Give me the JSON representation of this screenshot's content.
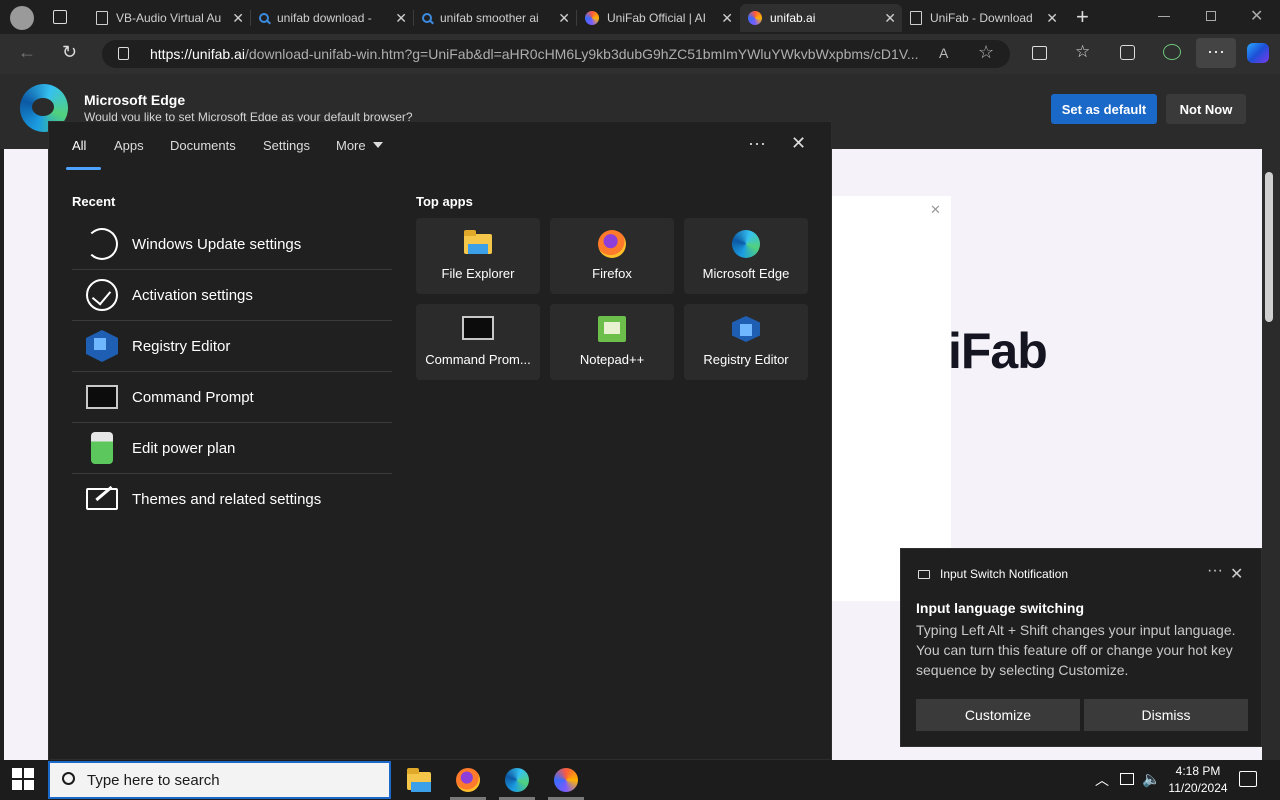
{
  "browser": {
    "tabs": [
      {
        "title": "VB-Audio Virtual Au",
        "icon": "page-icon"
      },
      {
        "title": "unifab download - ",
        "icon": "search-icon"
      },
      {
        "title": "unifab smoother ai",
        "icon": "search-icon"
      },
      {
        "title": "UniFab Official | AI",
        "icon": "unifab-icon"
      },
      {
        "title": "unifab.ai",
        "icon": "unifab-icon",
        "active": true
      },
      {
        "title": "UniFab - Download",
        "icon": "page-icon"
      }
    ],
    "url_host": "https://unifab.ai",
    "url_rest": "/download-unifab-win.htm?g=UniFab&dl=aHR0cHM6Ly9kb3dubG9hZC51bmImYWluYWkvbWxpbms/cD1V..."
  },
  "banner": {
    "title": "Microsoft Edge",
    "subtitle": "Would you like to set Microsoft Edge as your default browser?",
    "set_default": "Set as default",
    "not_now": "Not Now"
  },
  "webpage": {
    "brand_text": "iFab"
  },
  "search": {
    "tabs": [
      "All",
      "Apps",
      "Documents",
      "Settings",
      "More"
    ],
    "recent_title": "Recent",
    "recent": [
      {
        "label": "Windows Update settings",
        "icon": "refresh-icon"
      },
      {
        "label": "Activation settings",
        "icon": "check-circle-icon"
      },
      {
        "label": "Registry Editor",
        "icon": "registry-editor-icon"
      },
      {
        "label": "Command Prompt",
        "icon": "command-prompt-icon"
      },
      {
        "label": "Edit power plan",
        "icon": "battery-icon"
      },
      {
        "label": "Themes and related settings",
        "icon": "themes-icon"
      }
    ],
    "top_apps_title": "Top apps",
    "top_apps": [
      {
        "label": "File Explorer",
        "icon": "file-explorer-icon"
      },
      {
        "label": "Firefox",
        "icon": "firefox-icon"
      },
      {
        "label": "Microsoft Edge",
        "icon": "edge-icon"
      },
      {
        "label": "Command Prom...",
        "icon": "command-prompt-icon"
      },
      {
        "label": "Notepad++",
        "icon": "notepad-plus-plus-icon"
      },
      {
        "label": "Registry Editor",
        "icon": "registry-editor-icon"
      }
    ]
  },
  "notification": {
    "app": "Input Switch Notification",
    "title": "Input language switching",
    "body": "Typing Left Alt + Shift changes your input language. You can turn this feature off or change your hot key sequence by selecting Customize.",
    "customize": "Customize",
    "dismiss": "Dismiss"
  },
  "taskbar": {
    "search_placeholder": "Type here to search",
    "time": "4:18 PM",
    "date": "11/20/2024"
  },
  "colors": {
    "accent": "#1a68c7",
    "tab_underline": "#4da3ff"
  }
}
